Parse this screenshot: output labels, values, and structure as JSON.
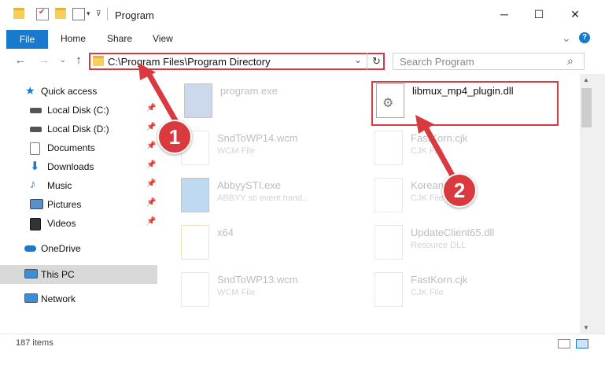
{
  "window": {
    "title": "Program",
    "minimize": "─",
    "maximize": "☐",
    "close": "✕"
  },
  "ribbon": {
    "file": "File",
    "tabs": [
      "Home",
      "Share",
      "View"
    ],
    "collapse": "⌄",
    "help": "?"
  },
  "address": {
    "back": "←",
    "forward": "→",
    "history": "⌄",
    "up": "↑",
    "path": "C:\\Program Files\\Program Directory",
    "dropdown": "⌄",
    "refresh": "↻"
  },
  "search": {
    "placeholder": "Search Program",
    "icon": "⌕"
  },
  "sidebar": {
    "items": [
      {
        "label": "Quick access",
        "icon": "star-icon",
        "pinned": false
      },
      {
        "label": "Local Disk (C:)",
        "icon": "drive-icon",
        "pinned": true
      },
      {
        "label": "Local Disk (D:)",
        "icon": "drive-icon",
        "pinned": true
      },
      {
        "label": "Documents",
        "icon": "documents-icon",
        "pinned": true
      },
      {
        "label": "Downloads",
        "icon": "downloads-icon",
        "pinned": true
      },
      {
        "label": "Music",
        "icon": "music-icon",
        "pinned": true
      },
      {
        "label": "Pictures",
        "icon": "pictures-icon",
        "pinned": true
      },
      {
        "label": "Videos",
        "icon": "videos-icon",
        "pinned": true
      },
      {
        "label": "OneDrive",
        "icon": "onedrive-icon",
        "pinned": false
      },
      {
        "label": "This PC",
        "icon": "pc-icon",
        "pinned": false
      },
      {
        "label": "Network",
        "icon": "network-icon",
        "pinned": false
      }
    ],
    "pin": "📌"
  },
  "files": [
    {
      "name": "program.exe",
      "type": ""
    },
    {
      "name": "libmux_mp4_plugin.dll",
      "type": ""
    },
    {
      "name": "SndToWP14.wcm",
      "type": "WCM File"
    },
    {
      "name": "FastKorn.cjk",
      "type": "CJK File"
    },
    {
      "name": "AbbyySTI.exe",
      "type": "ABBYY sti event hand..."
    },
    {
      "name": "Korean.cjk",
      "type": "CJK File"
    },
    {
      "name": "x64",
      "type": ""
    },
    {
      "name": "UpdateClient65.dll",
      "type": "Resource DLL"
    },
    {
      "name": "SndToWP13.wcm",
      "type": "WCM File"
    },
    {
      "name": "FastKorn.cjk",
      "type": "CJK File"
    }
  ],
  "status": {
    "count": "187 items"
  },
  "callouts": [
    "1",
    "2"
  ],
  "colors": {
    "accent": "#1979ca",
    "highlight": "#d93a3f"
  }
}
